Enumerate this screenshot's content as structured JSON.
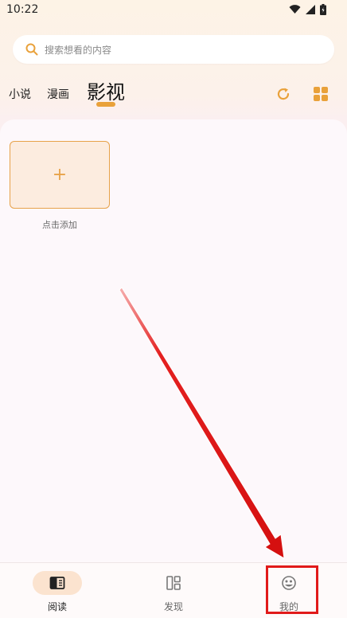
{
  "status_bar": {
    "time": "10:22",
    "icons": [
      "wifi-icon",
      "signal-icon",
      "battery-icon"
    ]
  },
  "search": {
    "placeholder": "搜索想看的内容"
  },
  "tabs": {
    "novel": "小说",
    "comic": "漫画",
    "video": "影视",
    "active": "影视"
  },
  "header_actions": [
    "refresh-icon",
    "grid-view-icon"
  ],
  "bookshelf": {
    "add_card_symbol": "+",
    "add_label": "点击添加"
  },
  "bottom_nav": {
    "items": [
      {
        "label": "阅读",
        "icon": "read-icon",
        "active": true
      },
      {
        "label": "发现",
        "icon": "discover-icon",
        "active": false
      },
      {
        "label": "我的",
        "icon": "profile-icon",
        "active": false
      }
    ]
  },
  "colors": {
    "accent": "#e9a13a",
    "annotation": "#e11a1a",
    "card_bg": "#fcecdf"
  }
}
